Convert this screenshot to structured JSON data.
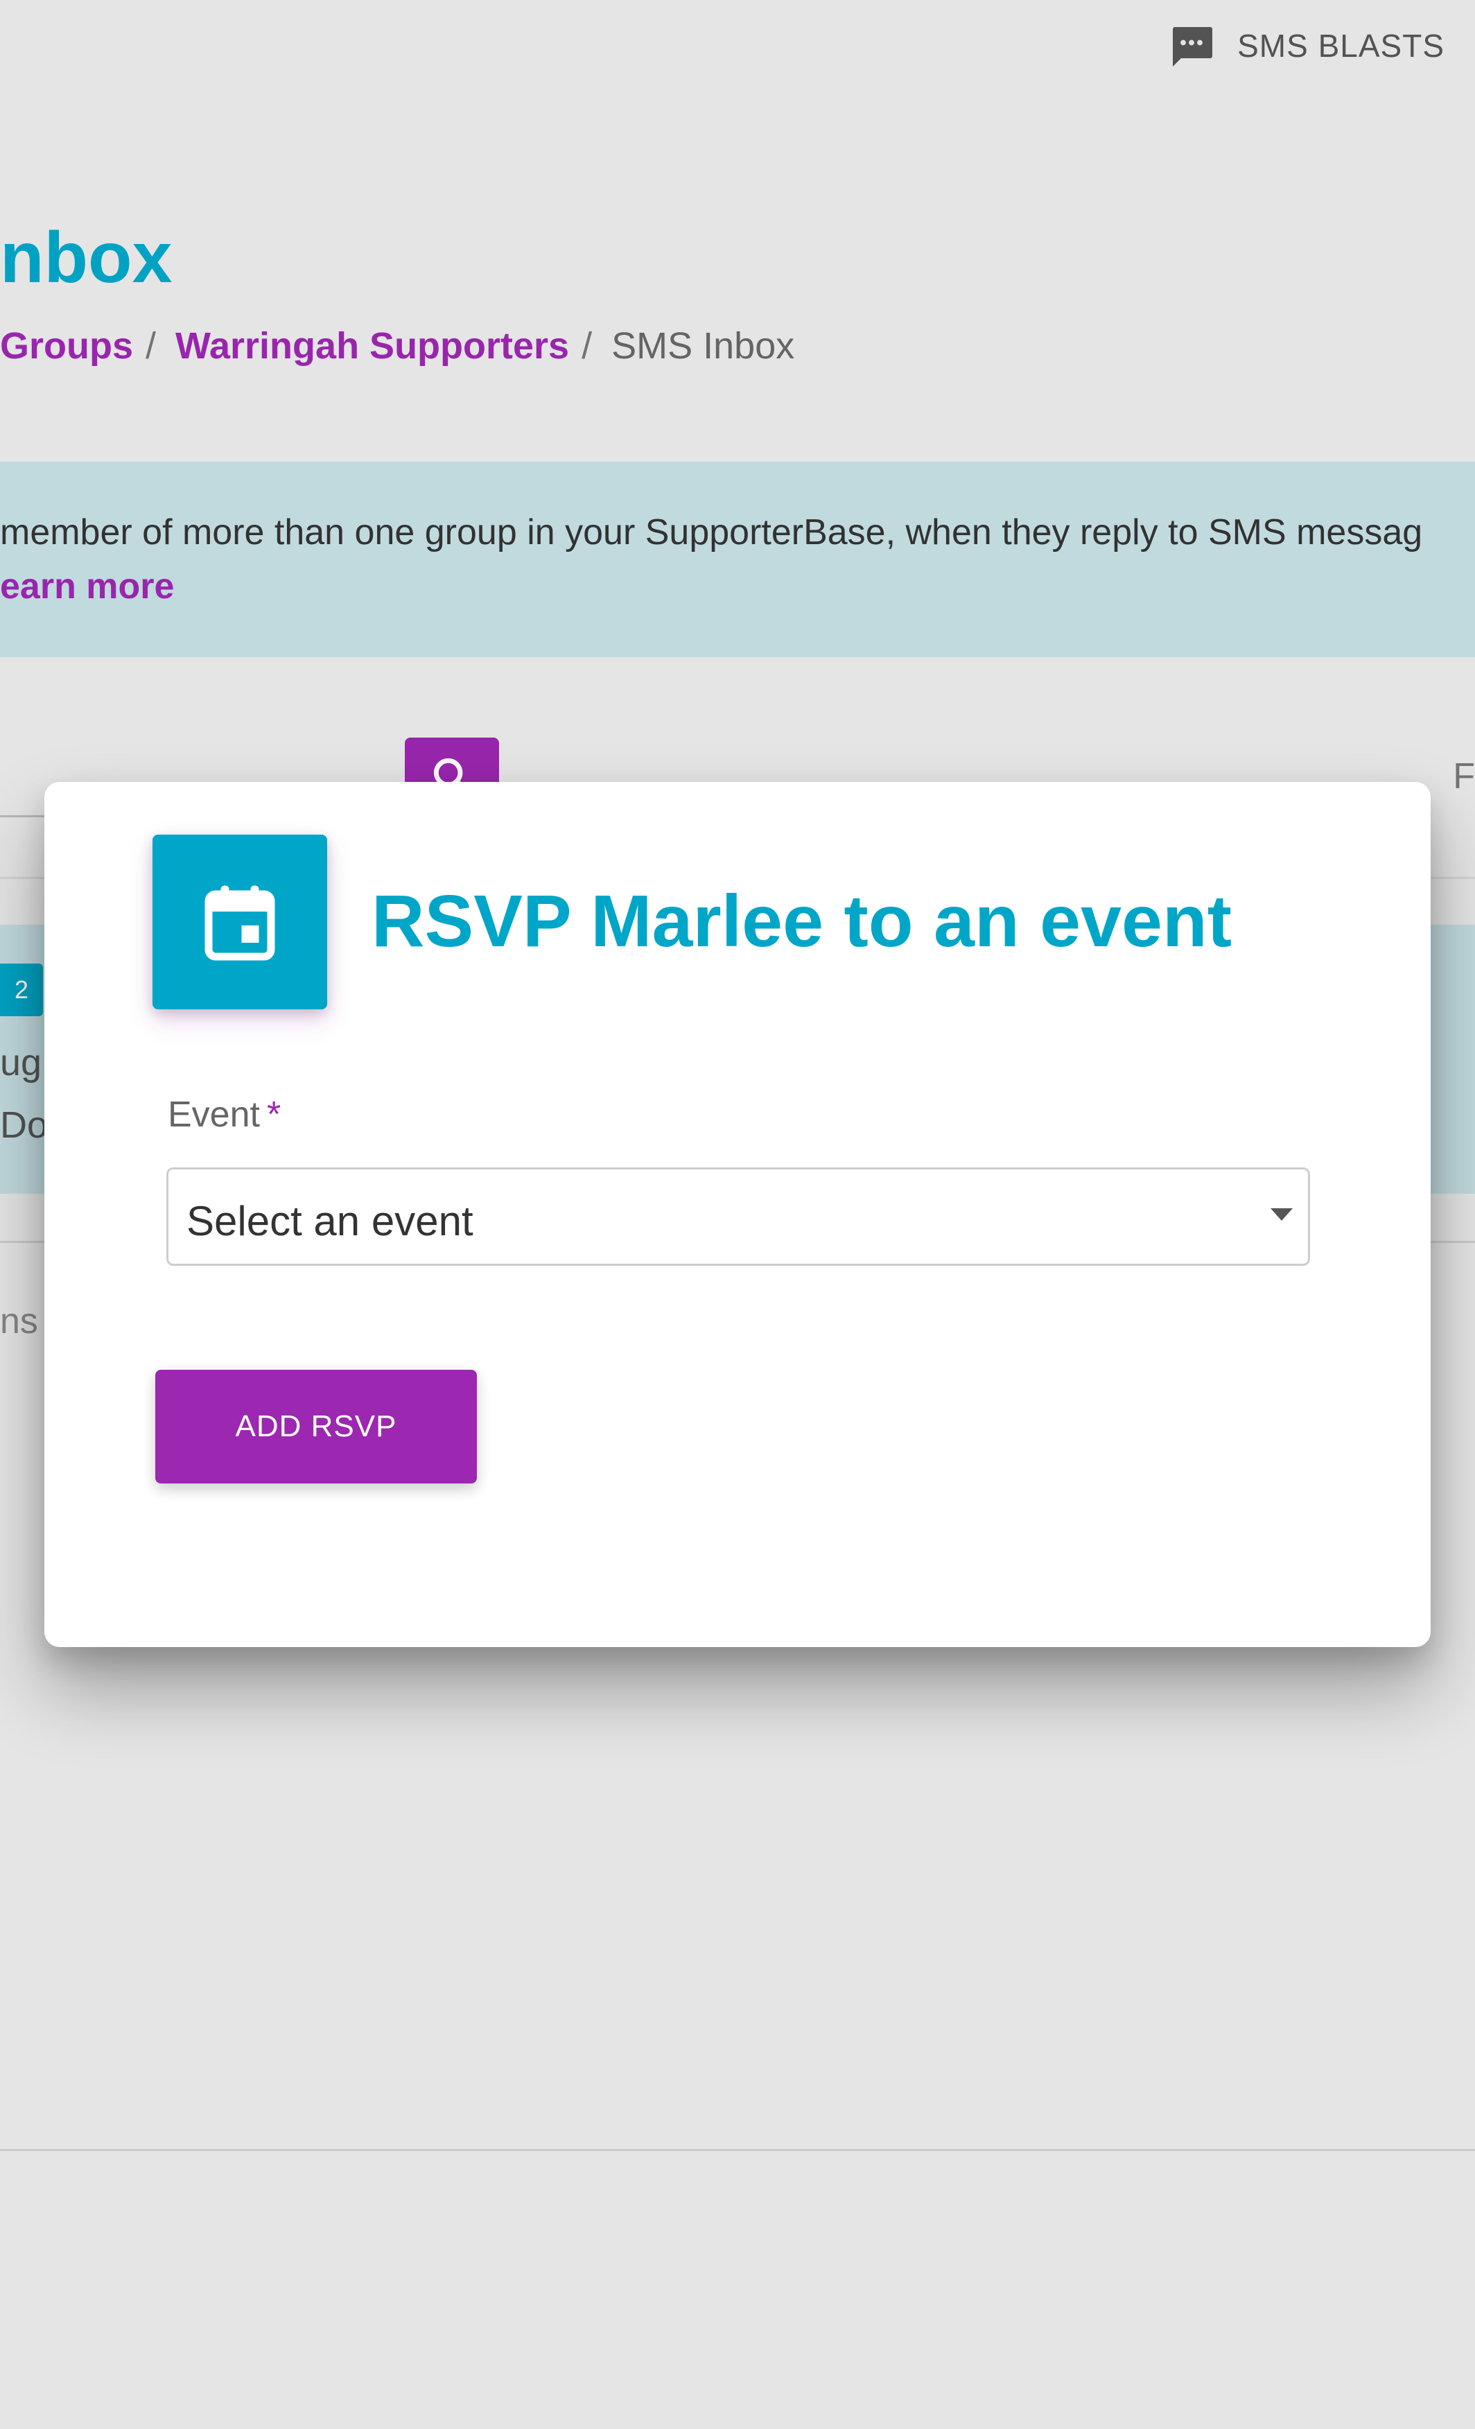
{
  "topbar": {
    "sms_blasts_label": "SMS BLASTS",
    "sms_icon": "chat-bubble-icon"
  },
  "page": {
    "title_fragment": "nbox",
    "breadcrumb": {
      "groups": "Groups",
      "group_name": "Warringah Supporters",
      "current": "SMS Inbox",
      "separator": "/"
    }
  },
  "banner": {
    "message_fragment": "member of more than one group in your SupporterBase, when they reply to SMS messag",
    "learn_more_fragment": "earn more"
  },
  "background_list": {
    "search_icon": "search-icon",
    "cut_text_right": "F",
    "badge_count": "2",
    "row_text_1": "ug",
    "row_text_2": "Do",
    "row_text_3": "ns"
  },
  "modal": {
    "icon": "calendar-icon",
    "title": "RSVP Marlee to an event",
    "field_label": "Event",
    "required_marker": "*",
    "select_placeholder": "Select an event",
    "add_button_label": "ADD RSVP"
  },
  "colors": {
    "brand_teal": "#00a6c7",
    "brand_purple": "#9c27b0",
    "banner_bg": "#c5dfe3",
    "page_bg": "#eaeaea"
  }
}
